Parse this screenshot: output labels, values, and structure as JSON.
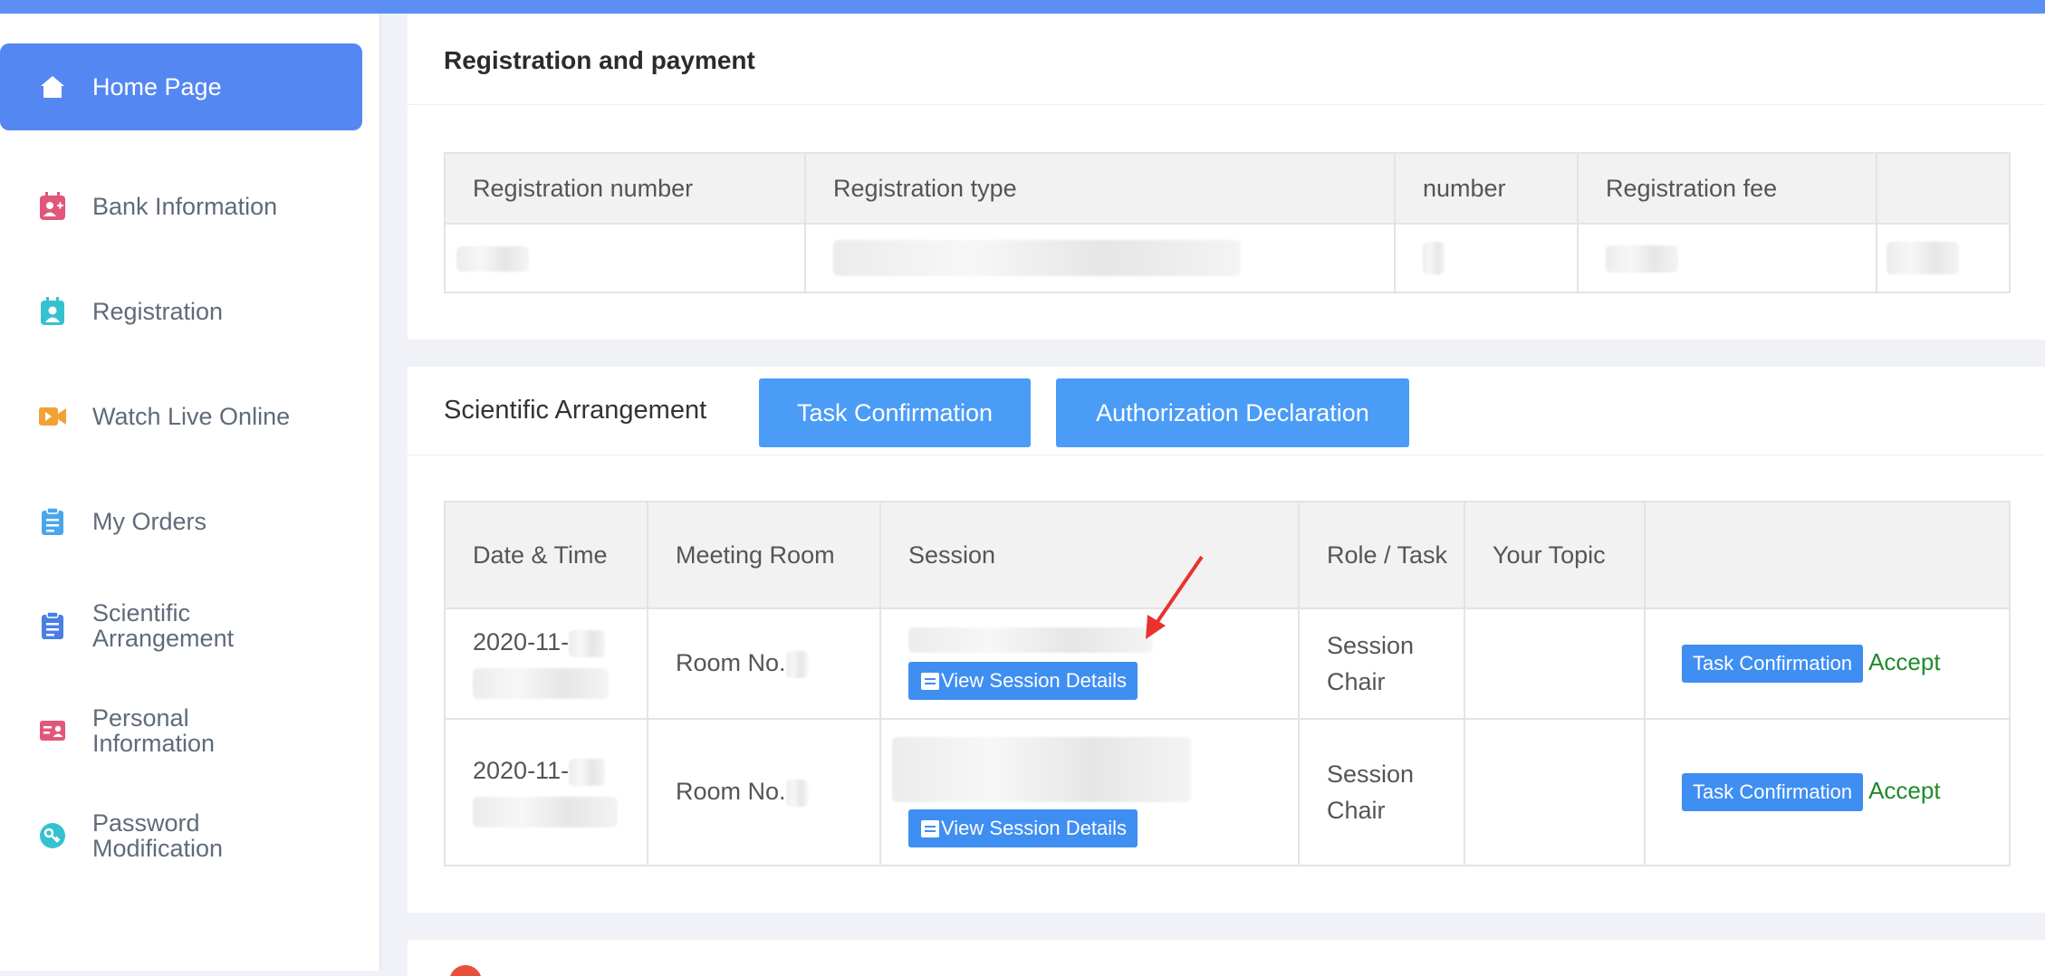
{
  "sidebar": {
    "items": [
      {
        "label": "Home Page",
        "icon": "home-icon",
        "active": true
      },
      {
        "label": "Bank Information",
        "icon": "bank-user-icon",
        "color": "#e0577a"
      },
      {
        "label": "Registration",
        "icon": "badge-icon",
        "color": "#36c1d0"
      },
      {
        "label": "Watch Live Online",
        "icon": "video-icon",
        "color": "#f0a236"
      },
      {
        "label": "My Orders",
        "icon": "clipboard-icon",
        "color": "#4aa6ea"
      },
      {
        "label": "Scientific Arrangement",
        "icon": "clipboard-list-icon",
        "color": "#4a7fe3"
      },
      {
        "label": "Personal Information",
        "icon": "id-card-icon",
        "color": "#e0577a"
      },
      {
        "label": "Password Modification",
        "icon": "key-icon",
        "color": "#36c1d0"
      }
    ]
  },
  "registration": {
    "title": "Registration and payment",
    "columns": [
      "Registration number",
      "Registration type",
      "number",
      "Registration fee",
      ""
    ]
  },
  "scientific": {
    "title": "Scientific Arrangement",
    "task_button": "Task Confirmation",
    "auth_button": "Authorization Declaration",
    "columns": [
      "Date & Time",
      "Meeting Room",
      "Session",
      "Role / Task",
      "Your Topic",
      ""
    ],
    "rows": [
      {
        "date": "2020-11-",
        "room": "Room No.",
        "details": "View Session Details",
        "role": "Session Chair",
        "topic": "",
        "confirm": "Task Confirmation",
        "status": "Accept"
      },
      {
        "date": "2020-11-",
        "room": "Room No.",
        "details": "View Session Details",
        "role": "Session Chair",
        "topic": "",
        "confirm": "Task Confirmation",
        "status": "Accept"
      }
    ]
  },
  "colors": {
    "accent": "#5587f2",
    "button": "#4a9cf7",
    "accept": "#1f8a2c",
    "arrow": "#e8322c"
  }
}
